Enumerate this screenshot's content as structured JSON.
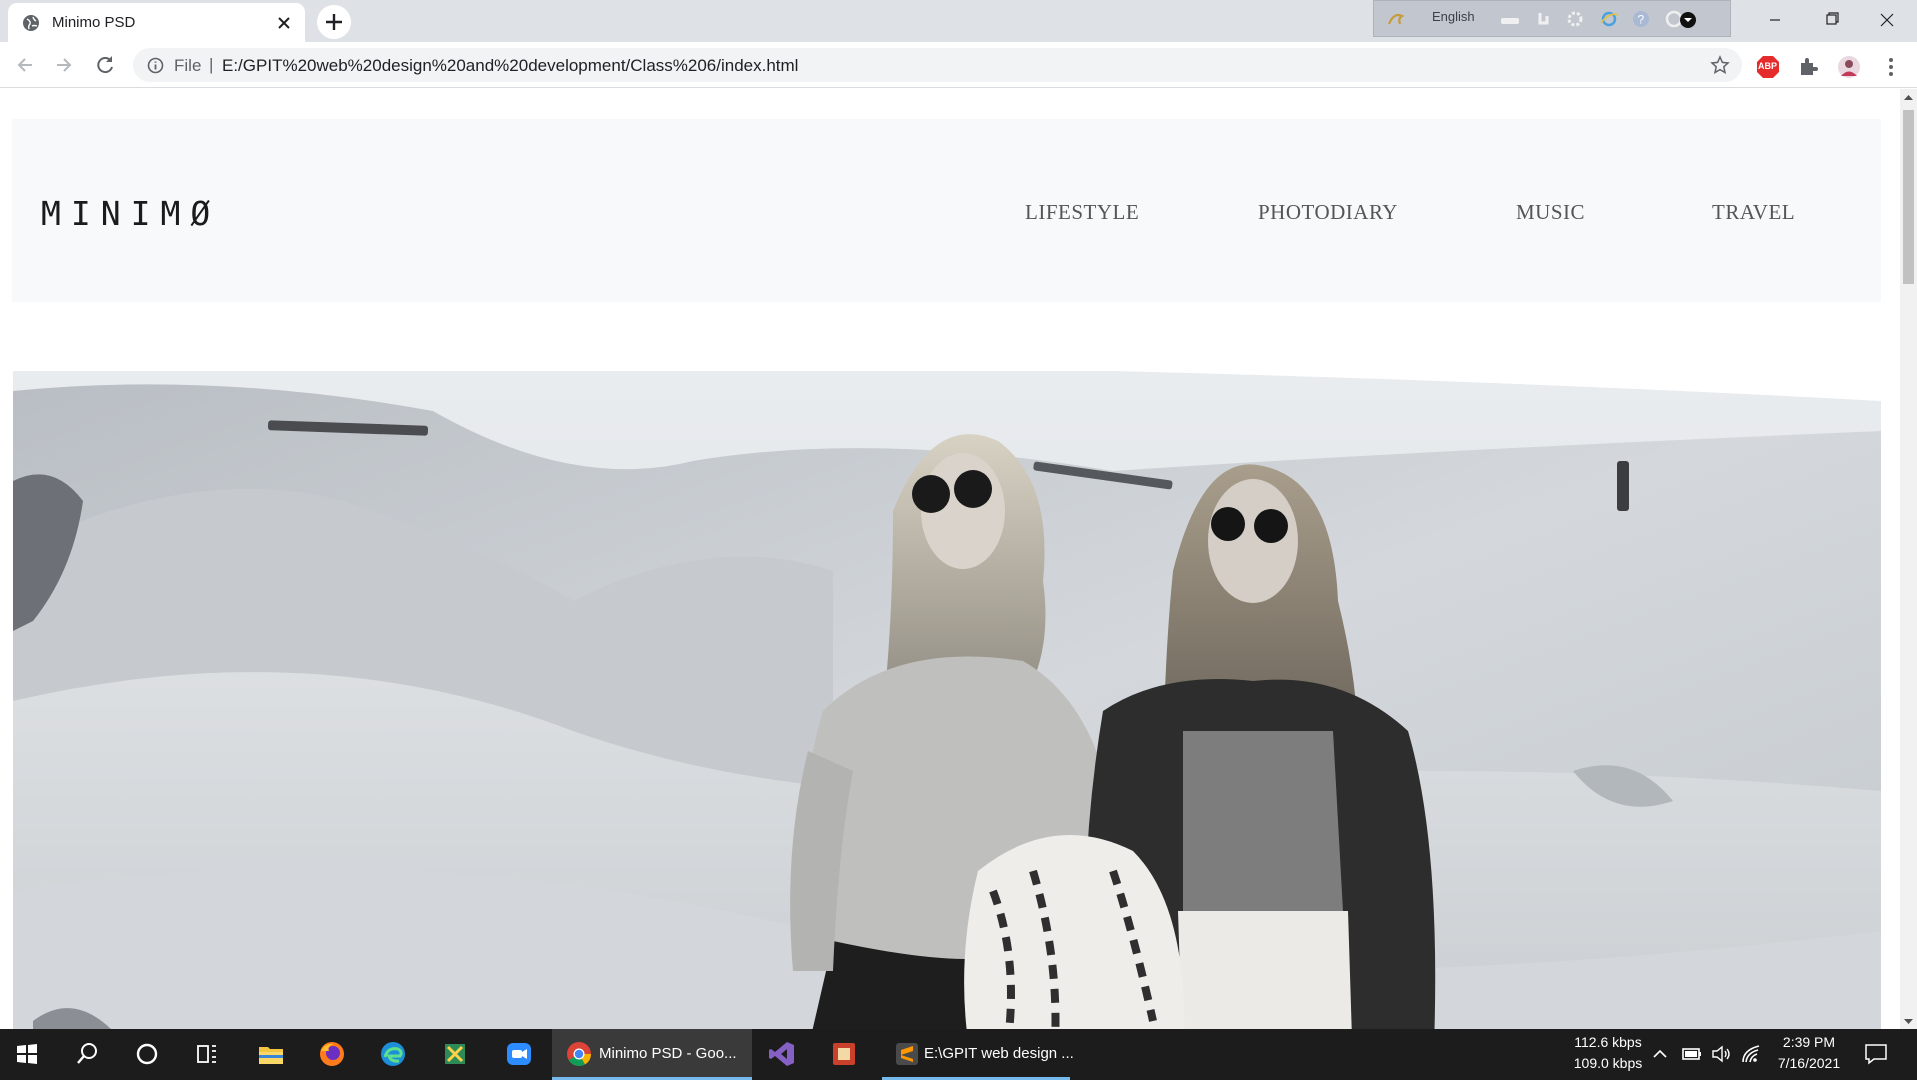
{
  "browser": {
    "tab_title": "Minimo PSD",
    "ime_language": "English",
    "omnibox": {
      "scheme_label": "File",
      "separator": "|",
      "url": "E:/GPIT%20web%20design%20and%20development/Class%206/index.html"
    },
    "extension_badge": "ABP"
  },
  "site": {
    "logo": "MINIMØ",
    "nav": [
      "LIFESTYLE",
      "PHOTODIARY",
      "MUSIC",
      "TRAVEL"
    ]
  },
  "taskbar": {
    "apps": [
      {
        "label": "Minimo PSD - Goo..."
      },
      {
        "label": "E:\\GPIT web design ..."
      }
    ],
    "network_up": "112.6 kbps",
    "network_down": "109.0 kbps",
    "time": "2:39 PM",
    "date": "7/16/2021"
  },
  "colors": {
    "accent": "#76b9ed",
    "header_bg": "#f8f9fa",
    "taskbar_bg": "#1c1c1c"
  }
}
